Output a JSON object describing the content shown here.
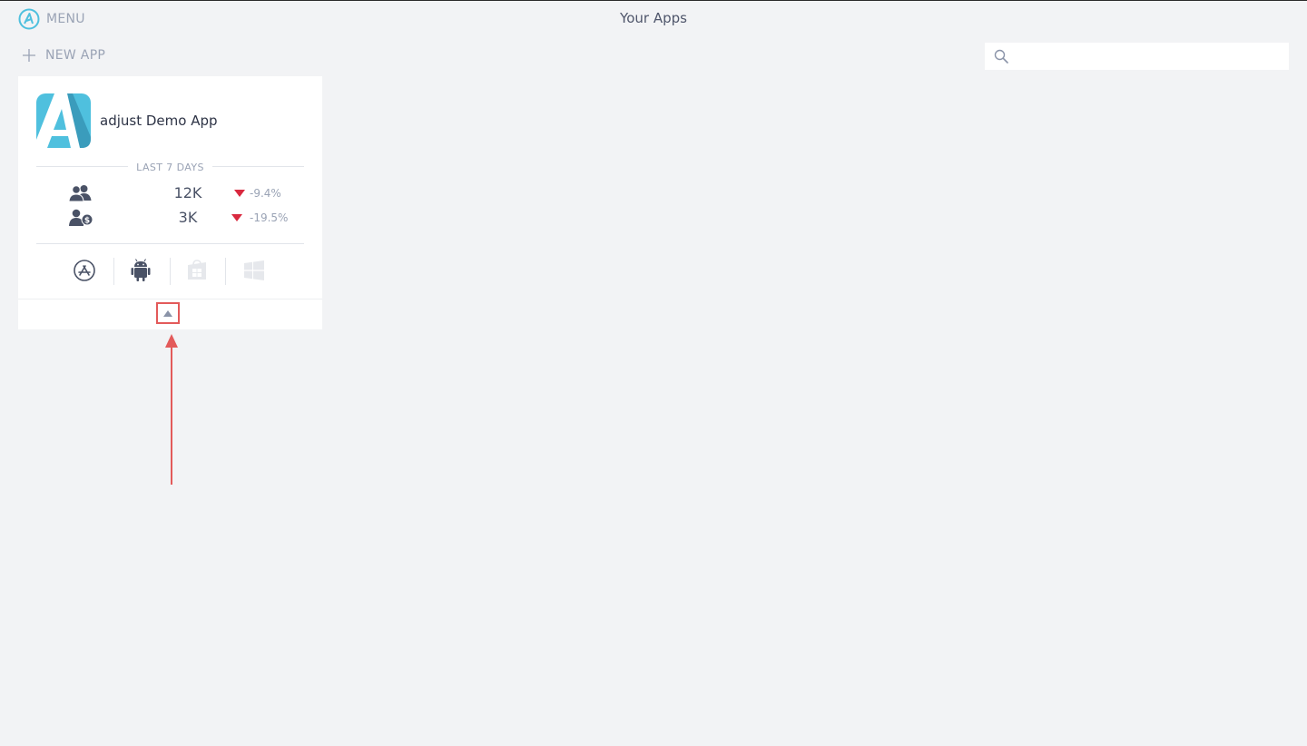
{
  "header": {
    "menu_label": "MENU",
    "menu_icon": "adjust-logo-icon",
    "title": "Your Apps"
  },
  "toolbar": {
    "new_app_label": "NEW APP",
    "new_app_icon": "plus-icon",
    "search_placeholder": "",
    "search_value": "",
    "search_icon": "search-icon"
  },
  "app_card": {
    "name": "adjust Demo App",
    "icon": "adjust-app-icon",
    "period_label": "LAST 7 DAYS",
    "metrics": [
      {
        "icon": "users-icon",
        "value": "12K",
        "change": "-9.4%",
        "trend": "down"
      },
      {
        "icon": "paying-users-icon",
        "value": "3K",
        "change": "-19.5%",
        "trend": "down"
      }
    ],
    "platforms": [
      {
        "icon": "app-store-icon",
        "enabled": true
      },
      {
        "icon": "android-icon",
        "enabled": true
      },
      {
        "icon": "windows-store-icon",
        "enabled": false
      },
      {
        "icon": "windows-icon",
        "enabled": false
      }
    ],
    "collapse_icon": "caret-up-icon"
  },
  "annotation": {
    "color": "#e35a5a",
    "icon": "arrow-up-annotation"
  },
  "colors": {
    "background": "#f2f3f5",
    "accent": "#4fc0de",
    "negative": "#d9293f",
    "muted_text": "#9aa3b5",
    "text": "#4a5266"
  }
}
